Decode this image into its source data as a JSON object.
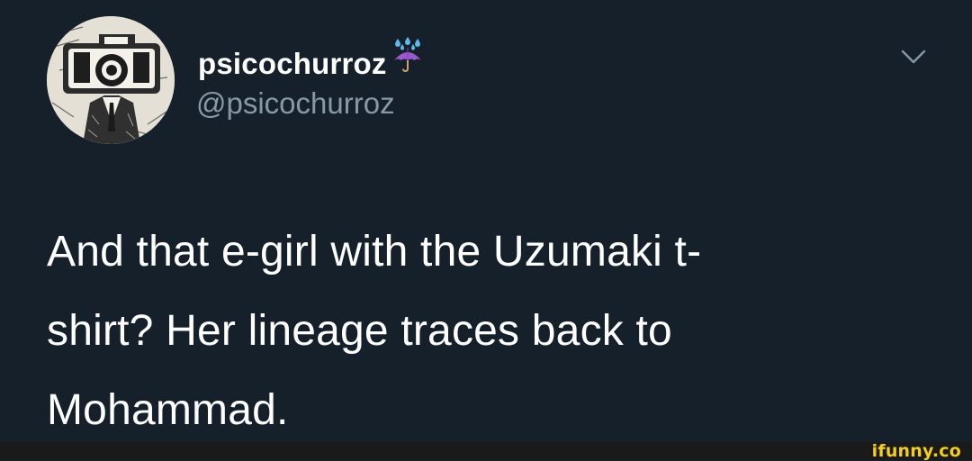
{
  "tweet": {
    "display_name": "psicochurroz",
    "display_name_emoji": "umbrella-with-rain-drops-icon",
    "handle": "@psicochurroz",
    "text_lines": [
      "And that e-girl with the Uzumaki t-",
      "shirt? Her lineage traces back to",
      "Mohammad."
    ],
    "menu_icon": "chevron-down-icon"
  },
  "watermark": {
    "text": "ifunny.co"
  },
  "colors": {
    "background": "#15202b",
    "primary_text": "#ffffff",
    "secondary_text": "#8899a6",
    "footer_bar": "#1a1a1a",
    "watermark": "#f3ce1b"
  }
}
